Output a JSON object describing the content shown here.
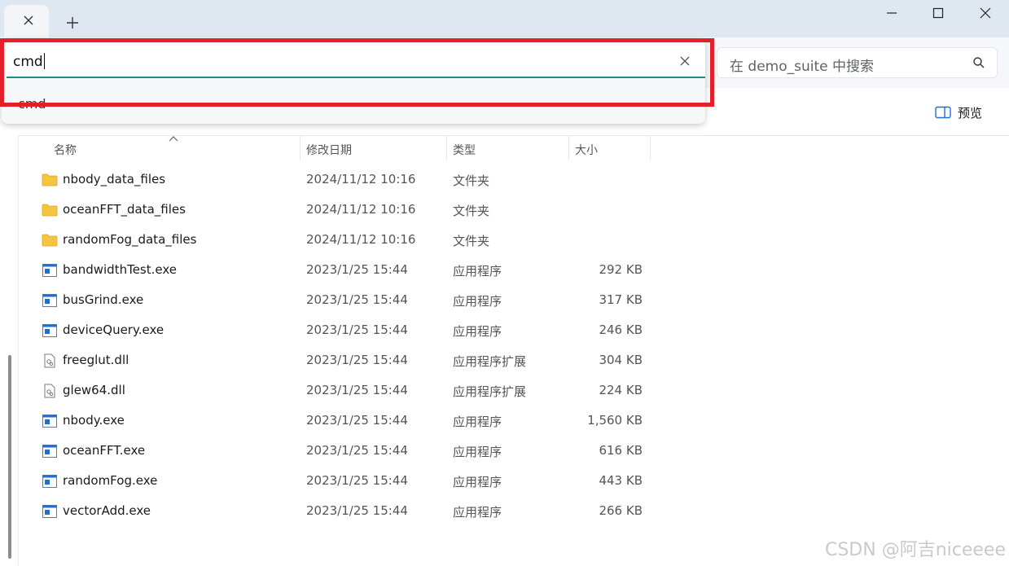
{
  "window": {
    "tab_close": "✕",
    "new_tab": "+",
    "minimize": "—",
    "maximize": "☐",
    "close": "✕"
  },
  "address_bar": {
    "value": "cmd",
    "suggestions": [
      "cmd"
    ]
  },
  "search": {
    "placeholder": "在 demo_suite 中搜索"
  },
  "toolbar": {
    "preview_label": "预览"
  },
  "columns": {
    "name": "名称",
    "date": "修改日期",
    "type": "类型",
    "size": "大小"
  },
  "files": [
    {
      "name": "nbody_data_files",
      "date": "2024/11/12 10:16",
      "type": "文件夹",
      "size": "",
      "icon": "folder-icon"
    },
    {
      "name": "oceanFFT_data_files",
      "date": "2024/11/12 10:16",
      "type": "文件夹",
      "size": "",
      "icon": "folder-icon"
    },
    {
      "name": "randomFog_data_files",
      "date": "2024/11/12 10:16",
      "type": "文件夹",
      "size": "",
      "icon": "folder-icon"
    },
    {
      "name": "bandwidthTest.exe",
      "date": "2023/1/25 15:44",
      "type": "应用程序",
      "size": "292 KB",
      "icon": "exe-icon"
    },
    {
      "name": "busGrind.exe",
      "date": "2023/1/25 15:44",
      "type": "应用程序",
      "size": "317 KB",
      "icon": "exe-icon"
    },
    {
      "name": "deviceQuery.exe",
      "date": "2023/1/25 15:44",
      "type": "应用程序",
      "size": "246 KB",
      "icon": "exe-icon"
    },
    {
      "name": "freeglut.dll",
      "date": "2023/1/25 15:44",
      "type": "应用程序扩展",
      "size": "304 KB",
      "icon": "dll-icon"
    },
    {
      "name": "glew64.dll",
      "date": "2023/1/25 15:44",
      "type": "应用程序扩展",
      "size": "224 KB",
      "icon": "dll-icon"
    },
    {
      "name": "nbody.exe",
      "date": "2023/1/25 15:44",
      "type": "应用程序",
      "size": "1,560 KB",
      "icon": "exe-icon"
    },
    {
      "name": "oceanFFT.exe",
      "date": "2023/1/25 15:44",
      "type": "应用程序",
      "size": "616 KB",
      "icon": "exe-icon"
    },
    {
      "name": "randomFog.exe",
      "date": "2023/1/25 15:44",
      "type": "应用程序",
      "size": "443 KB",
      "icon": "exe-icon"
    },
    {
      "name": "vectorAdd.exe",
      "date": "2023/1/25 15:44",
      "type": "应用程序",
      "size": "266 KB",
      "icon": "exe-icon"
    }
  ],
  "watermark": "CSDN @阿吉niceeee",
  "colors": {
    "highlight": "#e3202a",
    "focus_underline": "#1a8f8a",
    "folder": "#f5c542",
    "exe": "#1f6fd1"
  }
}
